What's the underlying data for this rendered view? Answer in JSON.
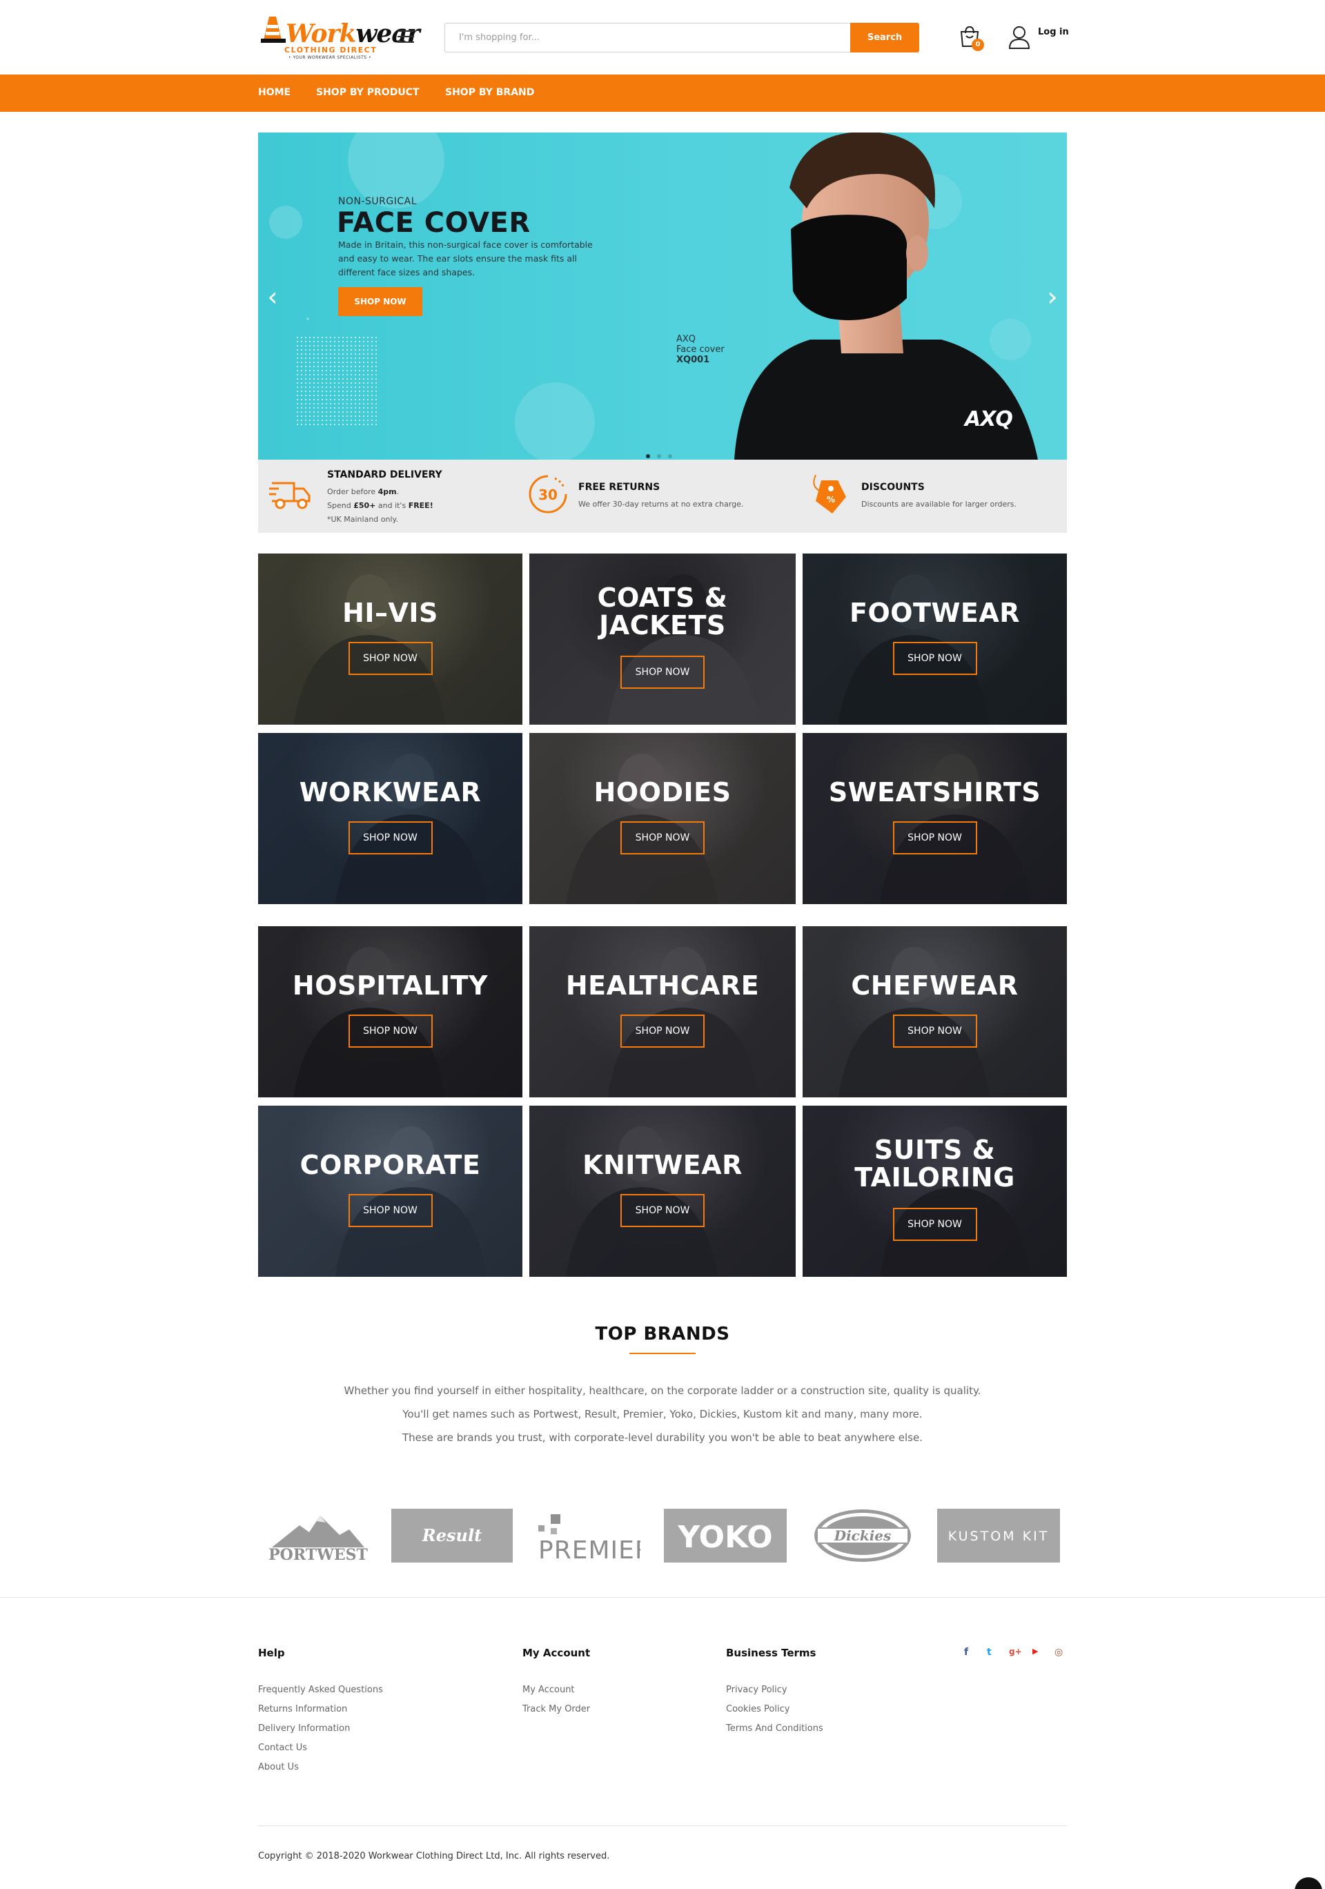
{
  "brand": {
    "logo_word_a": "Work",
    "logo_word_b": "wear",
    "logo_sub": "CLOTHING DIRECT",
    "logo_tag": "• YOUR WORKWEAR SPECIALISTS •",
    "accent": "#f47b0b"
  },
  "header": {
    "search_placeholder": "I'm shopping for...",
    "search_button": "Search",
    "cart_count": "0",
    "login": "Log in"
  },
  "nav": {
    "items": [
      "HOME",
      "SHOP BY PRODUCT",
      "SHOP BY BRAND"
    ]
  },
  "hero": {
    "kicker": "NON-SURGICAL",
    "title": "FACE COVER",
    "description": "Made in Britain, this non-surgical face cover is comfortable and easy to wear. The ear slots ensure the mask fits all different face sizes and shapes.",
    "button": "SHOP NOW",
    "product_brand": "AXQ",
    "product_name": "Face cover",
    "product_code": "XQ001",
    "watermark": "AXQ",
    "prev_arrow": "‹",
    "next_arrow": "›",
    "slides": 3,
    "active_slide": 1
  },
  "features": [
    {
      "icon": "delivery-truck-icon",
      "title": "STANDARD DELIVERY",
      "line1_pre": "Order before ",
      "line1_bold": "4pm",
      "line1_post": ".",
      "line2_pre": "Spend ",
      "line2_bold": "£50+",
      "line2_mid": " and it's ",
      "line2_bold2": "FREE!",
      "line3": "*UK Mainland only."
    },
    {
      "icon": "returns-30-icon",
      "icon_text": "30",
      "title": "FREE RETURNS",
      "line1": "We offer 30-day returns at no extra charge."
    },
    {
      "icon": "discount-tag-icon",
      "title": "DISCOUNTS",
      "line1": "Discounts are available for larger orders."
    }
  ],
  "categories": {
    "button": "SHOP NOW",
    "items": [
      {
        "name": "HI–VIS"
      },
      {
        "name": "COATS & JACKETS"
      },
      {
        "name": "FOOTWEAR"
      },
      {
        "name": "WORKWEAR"
      },
      {
        "name": "HOODIES"
      },
      {
        "name": "SWEATSHIRTS"
      },
      {
        "name": "HOSPITALITY"
      },
      {
        "name": "HEALTHCARE"
      },
      {
        "name": "CHEFWEAR"
      },
      {
        "name": "CORPORATE"
      },
      {
        "name": "KNITWEAR"
      },
      {
        "name": "SUITS & TAILORING"
      }
    ]
  },
  "brands": {
    "title": "TOP BRANDS",
    "paragraphs": [
      "Whether you find yourself in either hospitality, healthcare, on the corporate ladder or a construction site, quality is quality.",
      "You'll get names such as Portwest, Result, Premier, Yoko, Dickies, Kustom kit and many, many more.",
      "These are brands you trust, with corporate-level durability you won't be able to beat anywhere else."
    ],
    "logos": [
      "PORTWEST",
      "Result",
      "PREMIER",
      "YOKO",
      "Dickies",
      "KUSTOM KIT"
    ]
  },
  "footer": {
    "help": {
      "title": "Help",
      "links": [
        "Frequently Asked Questions",
        "Returns Information",
        "Delivery Information",
        "Contact Us",
        "About Us"
      ]
    },
    "account": {
      "title": "My Account",
      "links": [
        "My Account",
        "Track My Order"
      ]
    },
    "terms": {
      "title": "Business Terms",
      "links": [
        "Privacy Policy",
        "Cookies Policy",
        "Terms And Conditions"
      ]
    },
    "social": [
      {
        "icon": "facebook-icon",
        "glyph": "f",
        "color": "#3b5998"
      },
      {
        "icon": "twitter-icon",
        "glyph": "t",
        "color": "#1da1f2"
      },
      {
        "icon": "google-plus-icon",
        "glyph": "g+",
        "color": "#dd4b39"
      },
      {
        "icon": "youtube-icon",
        "glyph": "▶",
        "color": "#e62117"
      },
      {
        "icon": "instagram-icon",
        "glyph": "◎",
        "color": "#a0522d"
      }
    ],
    "copyright": "Copyright © 2018-2020 Workwear Clothing Direct Ltd, Inc. All rights reserved."
  }
}
